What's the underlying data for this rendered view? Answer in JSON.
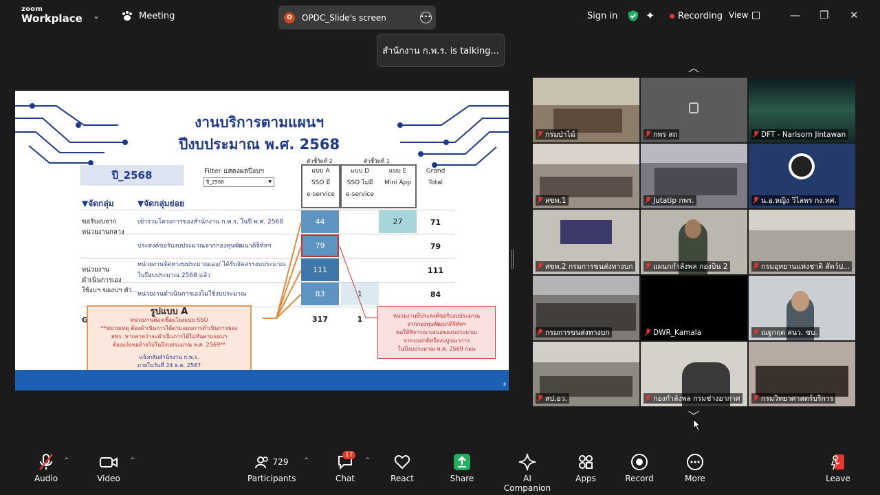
{
  "app": {
    "brand_small": "zoom",
    "brand_name": "Workplace"
  },
  "top": {
    "meeting_label": "Meeting",
    "share_pill": "OPDC_Slide's screen",
    "share_pill_icon_letter": "O",
    "sign_in": "Sign in",
    "recording": "Recording",
    "view": "View"
  },
  "talking": "สำนักงาน ก.พ.ร. is talking...",
  "slide": {
    "title_line1": "งานบริการตามแผนฯ",
    "title_line2": "ปีงบประมาณ พ.ศ. 2568",
    "year": "ปี_2568",
    "filter_label": "Filter แสดงผลปีงบฯ",
    "filter_value": "ปี_2568",
    "indicator2": "ตัวชี้วัดที่ 2",
    "indicator1": "ตัวชี้วัดที่ 1",
    "col_a": [
      "แบบ A",
      "SSO      มี",
      "e-service"
    ],
    "col_d": [
      "แบบ D",
      "SSO ไม่มี",
      "e-service"
    ],
    "col_e": [
      "แบบ E",
      "Mini App"
    ],
    "col_total": [
      "Grand",
      "Total"
    ],
    "group_header": "▼จัดกลุ่ม",
    "subgroup_header": "▼จัดกลุ่มย่อย",
    "group1": [
      "ขอรับงบจาก",
      "หน่วยงานกลาง"
    ],
    "group2": [
      "หน่วยงาน",
      "ดำเนินการเอง",
      "ใช้งบฯ ของบฯ ตัว..."
    ],
    "rows": [
      {
        "label": "เข้าร่วมโครงการของสำนักงาน ก.พ.ร. ในปี พ.ศ. 2568",
        "a": "44",
        "d": "",
        "e": "27",
        "total": "71"
      },
      {
        "label": "ประสงค์ขอรับงบประมาณจากกองทุนพัฒนาดิจิทัลฯ",
        "a": "79",
        "d": "",
        "e": "",
        "total": "79"
      },
      {
        "label": "หน่วยงานจัดหางบประมาณเอง/ ได้รับจัดสรรงบประมาณ ในปีงบประมาณ 2568 แล้ว",
        "a": "111",
        "d": "",
        "e": "",
        "total": "111"
      },
      {
        "label": "หน่วยงานดำเนินการเองไม่ใช้งบประมาณ",
        "a": "83",
        "d": "1",
        "e": "",
        "total": "84"
      }
    ],
    "grand_row": {
      "label": "G",
      "a": "317",
      "d": "1"
    },
    "callout_a_title": "รูปแบบ A",
    "callout_a_lines": [
      "หน่วยงานต้องเชื่อมโยงแบบ SSO",
      "**หมายเหตุ ต้องดำเนินการได้ตามแผนการดำเนินการของ",
      "สพร. หากคาดว่าจะดำเนินการได้ไม่ทันตามแผนฯ",
      "ต้องแจ้งขอย้ายไปในปีงบประมาณ พ.ศ. 2569**"
    ],
    "callout_a_footer": [
      "แจ้งกลับสำนักงาน ก.พ.ร.",
      "ภายในวันที่ 24 ธ.ค. 2567"
    ],
    "callout_b_lines": [
      "หน่วยงานที่ประสงค์ขอรับงบประมาณ",
      "จากกองทุนพัฒนาดิจิทัลฯ",
      "ขอให้พิจารณาเสนอของบประมาณ",
      "จากงบปกติหรืองบบูรณาการ",
      "ในปีงบประมาณ พ.ศ. 2569 ก่อน"
    ],
    "page_num": "8"
  },
  "participants": [
    "กรมป่าไม้",
    "กพร สถ",
    "DFT - Narisorn Jintawan",
    "สขพ.1",
    "Jutatip กพร.",
    "น.อ.หญิง วิไลพร กง.ทศ.",
    "สขพ.2 กรมการขนส่งทางบก",
    "แผนกกำลังพล กองบิน 2",
    "กรมอุทยานแห่งชาติ สัตว์ป...",
    "กรมการขนส่งทางบก",
    "DWR_Kamala",
    "ณฐกฤต   สนว. ชบ.",
    "สป.อว.",
    "กองกำลังพล กรมช่างอากาศ",
    "กรมวิทยาศาสตร์บริการ"
  ],
  "toolbar": {
    "audio": "Audio",
    "video": "Video",
    "participants_count": "729",
    "participants": "Participants",
    "chat_badge": "17",
    "chat": "Chat",
    "react": "React",
    "share": "Share",
    "ai": "AI Companion",
    "apps": "Apps",
    "record": "Record",
    "more": "More",
    "leave": "Leave"
  },
  "colors": {
    "share_green": "#1fae5b",
    "leave_red": "#e5372d",
    "slide_blue": "#1d3a8a"
  }
}
